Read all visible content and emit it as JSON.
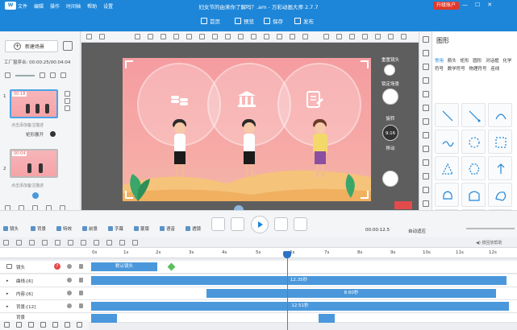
{
  "app": {
    "logo": "W",
    "menu": [
      "文件",
      "编辑",
      "操作",
      "时间轴",
      "帮助",
      "设置"
    ],
    "title": "妇女节的由来你了解吗？.am - 万彩动画大师 2.7.7",
    "upgrade_label": "升级账户",
    "window_buttons": [
      "—",
      "☐",
      "✕"
    ]
  },
  "toolbar": {
    "items": [
      {
        "label": "首页",
        "icon": "home-icon"
      },
      {
        "label": "预览",
        "icon": "preview-icon"
      },
      {
        "label": "保存",
        "icon": "save-icon"
      },
      {
        "label": "发布",
        "icon": "publish-icon"
      }
    ]
  },
  "leftpanel": {
    "new_scene_label": "新建场景",
    "timing_label": "工厂窗序合: 00:00:25/00:04:04",
    "scenes": [
      {
        "number": "1",
        "tag": "00:18",
        "caption": "点击添加备注描述",
        "name": "矩形展开"
      },
      {
        "number": "2",
        "tag": "00:04",
        "caption": "点击添加备注描述"
      }
    ]
  },
  "stage_controls": {
    "reset_label": "重置镜头",
    "lock_label": "锁定场景",
    "rotate_label": "旋转",
    "ratio_label": "9:16",
    "move_label": "移动"
  },
  "rightpanel": {
    "title": "图形",
    "categories": [
      "常用",
      "箭头",
      "矩形",
      "圆形",
      "对话框",
      "化学符号",
      "数学符号",
      "物理符号",
      "连线"
    ],
    "active_category": "常用",
    "shapes": [
      "line-diag-icon",
      "line-diag2-icon",
      "arc-icon",
      "wave-icon",
      "dashed-circle-icon",
      "dashed-square-icon",
      "triangle-icon",
      "hexagon-icon",
      "arrow-up-icon",
      "blob-icon",
      "blob2-icon",
      "blob3-icon",
      "step-icon",
      "step2-icon",
      "step3-icon"
    ]
  },
  "playbar": {
    "items": [
      {
        "label": "镜头",
        "color": "#3b8be0"
      },
      {
        "label": "背景",
        "color": "#3b8be0"
      },
      {
        "label": "特效",
        "color": "#3b8be0"
      },
      {
        "label": "前景",
        "color": "#3b8be0"
      },
      {
        "label": "字幕",
        "color": "#3b8be0"
      },
      {
        "label": "蒙版",
        "color": "#3b8be0"
      },
      {
        "label": "语音",
        "color": "#3b8be0"
      },
      {
        "label": "透镜",
        "color": "#3b8be0"
      }
    ],
    "time": "00:00:12.5",
    "auto_fit_label": "自动适应",
    "volume_note": "◀) 按回放帮助"
  },
  "timeline": {
    "ruler_labels": [
      "0s",
      "1s",
      "2s",
      "3s",
      "4s",
      "5s",
      "6s",
      "7s",
      "8s",
      "9s",
      "10s",
      "11s",
      "12s"
    ],
    "tracks": [
      {
        "label": "镜头",
        "badge": "?",
        "bar_label": "默认镜头"
      },
      {
        "label": "曲线-[6]",
        "bar_label": "12.35秒"
      },
      {
        "label": "内容-[6]",
        "bar_label": "8.60秒"
      },
      {
        "label": "背景-[12]",
        "bar_label": "12.51秒"
      },
      {
        "label": "背景",
        "bar_label": ""
      }
    ]
  }
}
